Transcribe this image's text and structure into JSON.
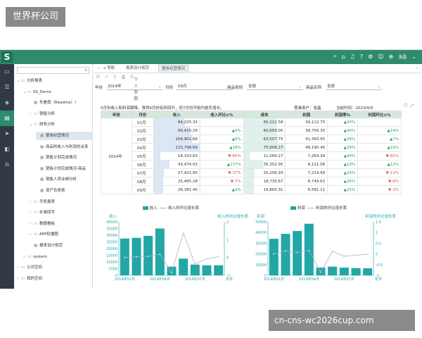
{
  "watermark_top": "世界杯公司",
  "watermark_bottom": "cn-cns-wc2026cup.com",
  "topbar": {
    "logo": "S",
    "user": "张晶"
  },
  "tree": {
    "items": [
      {
        "label": "分析报表",
        "level": 0,
        "car": "⌄",
        "icon": "▭"
      },
      {
        "label": "SS_Demo",
        "level": 1,
        "car": "⌄",
        "icon": "▭"
      },
      {
        "label": "先看我（Readme）!",
        "level": 2,
        "car": "",
        "icon": "▦"
      },
      {
        "label": "销售分析",
        "level": 2,
        "car": "›",
        "icon": "▭"
      },
      {
        "label": "财务分析",
        "level": 2,
        "car": "⌄",
        "icon": "▭"
      },
      {
        "label": "整体经营情况",
        "level": 3,
        "car": "",
        "icon": "▦",
        "selected": true
      },
      {
        "label": "商品的收入与利润的关系",
        "level": 3,
        "car": "",
        "icon": "▦"
      },
      {
        "label": "销售计划完成情况",
        "level": 3,
        "car": "",
        "icon": "▦"
      },
      {
        "label": "销售计划完成情况-商品",
        "level": 3,
        "car": "",
        "icon": "▦"
      },
      {
        "label": "销售人员业绩分析",
        "level": 3,
        "car": "",
        "icon": "▦"
      },
      {
        "label": "资产负债表",
        "level": 3,
        "car": "",
        "icon": "▦"
      },
      {
        "label": "手机报表",
        "level": 2,
        "car": "›",
        "icon": "▭"
      },
      {
        "label": "补录回写",
        "level": 2,
        "car": "›",
        "icon": "▭"
      },
      {
        "label": "数据看板",
        "level": 2,
        "car": "›",
        "icon": "▭"
      },
      {
        "label": "APP轮播图",
        "level": 2,
        "car": "›",
        "icon": "▭"
      },
      {
        "label": "报表设计规范",
        "level": 2,
        "car": "",
        "icon": "▦"
      },
      {
        "label": "system",
        "level": 1,
        "car": "›",
        "icon": "▭"
      },
      {
        "label": "公共空间",
        "level": 0,
        "car": "›",
        "icon": "▭"
      },
      {
        "label": "我的空间",
        "level": 0,
        "car": "›",
        "icon": "▭"
      }
    ]
  },
  "tabs": [
    {
      "label": "导航"
    },
    {
      "label": "报表设计规范"
    },
    {
      "label": "整体经营情况"
    }
  ],
  "toolbar": {
    "personal_param": "个人参数"
  },
  "filters": {
    "year_label": "年份",
    "year_value": "2014年",
    "month_label": "月份",
    "month_value": "09月",
    "category_label": "商品类别",
    "category_value": "全部",
    "name_label": "商品名称",
    "name_value": "全部"
  },
  "report": {
    "note": "5月份收入和利润骤降。虽然6月份有所回升，但7月份开始均是负增长。",
    "login_user": "登录用户：张晶",
    "current_time": "当前时间：2023/4/9",
    "headers": [
      "年份",
      "月份",
      "收入",
      "收入环比±%",
      "成本",
      "利润",
      "利润率%",
      "利润环比±%"
    ],
    "year": "2014年",
    "rows": [
      {
        "month": "01月",
        "income": "84,225.33",
        "income_mom": "",
        "cost": "60,112.58",
        "profit": "34,112.75",
        "margin": "▲40%",
        "profit_mom": ""
      },
      {
        "month": "02月",
        "income": "99,415.29",
        "income_mom": "▲4%",
        "cost": "60,659.05",
        "profit": "38,756.30",
        "margin": "▲40%",
        "profit_mom": "▲14%"
      },
      {
        "month": "03月",
        "income": "104,901.68",
        "income_mom": "▲6%",
        "cost": "63,507.75",
        "profit": "41,393.95",
        "margin": "▲39%",
        "profit_mom": "▲7%"
      },
      {
        "month": "04月",
        "income": "123,798.69",
        "income_mom": "▲18%",
        "cost": "75,608.27",
        "profit": "48,190.45",
        "margin": "▲38%",
        "profit_mom": "▲16%"
      },
      {
        "month": "05月",
        "income": "18,333.63",
        "income_mom": "▼-85%",
        "cost": "11,069.27",
        "profit": "7,264.39",
        "margin": "▲40%",
        "profit_mom": "▼-85%"
      },
      {
        "month": "06月",
        "income": "43,474.03",
        "income_mom": "▲137%",
        "cost": "35,352.95",
        "profit": "8,121.08",
        "margin": "▲19%",
        "profit_mom": "▲12%"
      },
      {
        "month": "07月",
        "income": "27,421.90",
        "income_mom": "▼-37%",
        "cost": "20,206.93",
        "profit": "7,214.99",
        "margin": "▲26%",
        "profit_mom": "▼-11%"
      },
      {
        "month": "08月",
        "income": "25,485.28",
        "income_mom": "▼-7%",
        "cost": "18,735.67",
        "profit": "6,749.62",
        "margin": "▲26%",
        "profit_mom": "▼-6%"
      },
      {
        "month": "09月",
        "income": "26,381.40",
        "income_mom": "▲4%",
        "cost": "19,800.31",
        "profit": "6,581.11",
        "margin": "▲25%",
        "profit_mom": "▼-2%"
      }
    ]
  },
  "chart_data": [
    {
      "type": "bar",
      "title": "",
      "legend": [
        "收入",
        "收入的环比增长率"
      ],
      "ylabel": "收入",
      "y2label": "收入的环比增长率",
      "xlabel_right": "年月",
      "ylim": [
        0,
        40000
      ],
      "y2lim": [
        -1,
        2
      ],
      "yticks": [
        "40000",
        "35000",
        "30000",
        "25000",
        "20000",
        "15000",
        "10000",
        "5000",
        "0"
      ],
      "y2ticks": [
        "2",
        "1",
        "0",
        "-1"
      ],
      "xticks": [
        "2014年01月",
        "2014年04月",
        "2014年07月"
      ],
      "series": [
        {
          "name": "收入",
          "values": [
            27500,
            28000,
            29500,
            35000,
            6500,
            12500,
            8000,
            7500,
            7500
          ]
        },
        {
          "name": "收入的环比增长率",
          "values": [
            0.0,
            0.04,
            0.06,
            0.18,
            -0.85,
            1.37,
            -0.37,
            -0.07,
            0.04
          ]
        }
      ]
    },
    {
      "type": "bar",
      "title": "",
      "legend": [
        "利润",
        "利润的环比增长率"
      ],
      "ylabel": "利润",
      "y2label": "利润的环比增长率",
      "xlabel_right": "年月",
      "ylim": [
        0,
        50000
      ],
      "y2lim": [
        -1,
        1.5
      ],
      "yticks": [
        "50000",
        "40000",
        "30000",
        "20000",
        "10000",
        "0"
      ],
      "y2ticks": [
        "1.5",
        "1",
        "0.5",
        "0",
        "-0.5",
        "-1"
      ],
      "xticks": [
        "2014年01月",
        "2014年04月",
        "2014年07月"
      ],
      "series": [
        {
          "name": "利润",
          "values": [
            34112.75,
            38756.3,
            41393.95,
            48190.45,
            7264.39,
            8121.08,
            7214.99,
            6749.62,
            6581.11
          ]
        },
        {
          "name": "利润的环比增长率",
          "values": [
            0.0,
            0.14,
            0.07,
            0.16,
            -0.85,
            0.12,
            -0.11,
            -0.06,
            -0.02
          ]
        }
      ]
    }
  ],
  "colors": {
    "accent": "#2e8b6e",
    "bar": "#22a6a6",
    "line": "#aab0c8",
    "header": "#d4e8dc",
    "income_shade": "#dbe7f5",
    "cost_shade": "#e0f0ec"
  }
}
